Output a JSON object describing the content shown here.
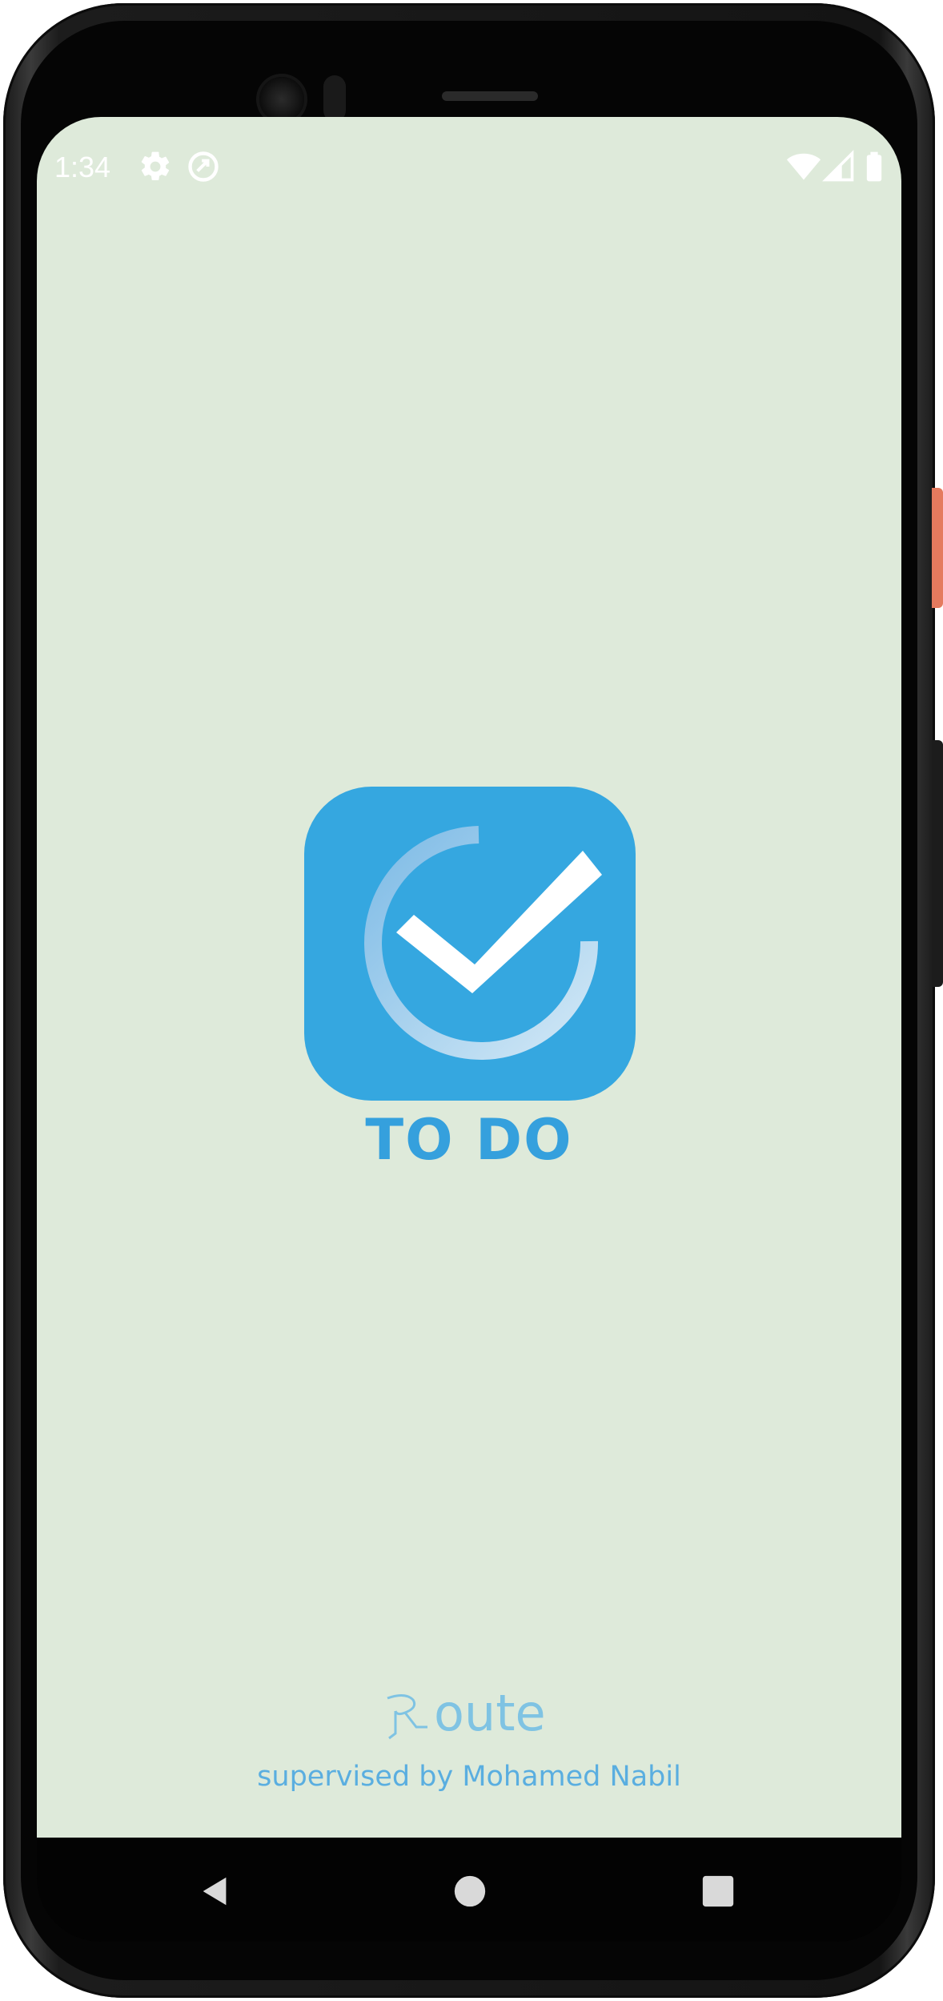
{
  "status_bar": {
    "time": "1:34",
    "left_icons": [
      "gear-icon",
      "data-saver-icon"
    ],
    "right_icons": [
      "wifi-icon",
      "cell-signal-icon",
      "battery-icon"
    ]
  },
  "splash": {
    "app_title": "TO DO",
    "brand_logo_text": "oute",
    "supervised_by": "supervised by Mohamed Nabil",
    "colors": {
      "background": "#deeada",
      "logo_blue": "#35a7e0",
      "title_blue": "#35a0dd",
      "footer_blue": "#5aaee0"
    }
  },
  "nav_bar": {
    "buttons": [
      "back-icon",
      "home-icon",
      "recents-icon"
    ]
  }
}
